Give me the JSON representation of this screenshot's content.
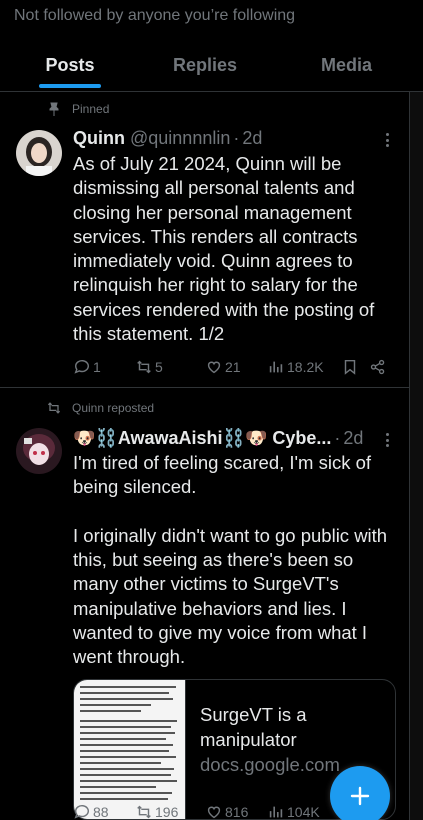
{
  "top_note": "Not followed by anyone you’re following",
  "tabs": [
    {
      "label": "Posts",
      "active": true
    },
    {
      "label": "Replies",
      "active": false
    },
    {
      "label": "Media",
      "active": false
    }
  ],
  "colors": {
    "accent": "#1d9bf0",
    "background": "#000000",
    "muted": "#71767b",
    "text": "#e7e9ea"
  },
  "posts": [
    {
      "context": "Pinned",
      "context_icon": "pin-icon",
      "name": "Quinn",
      "handle": "@quinnnnlin",
      "time": "2d",
      "text": "As of July 21 2024, Quinn will be dismissing all personal talents and closing her personal management services. This renders all contracts immediately void. Quinn agrees to relinquish her right to salary for the services rendered with the posting of this statement. 1/2",
      "replies": "1",
      "reposts": "5",
      "likes": "21",
      "views": "18.2K"
    },
    {
      "context": "Quinn reposted",
      "context_icon": "repost-icon",
      "name": "🐶⛓️AwawaAishi⛓️🐶 Cybe...",
      "time": "2d",
      "text": "I'm tired of feeling scared, I'm sick of being silenced.\n\nI originally didn't want to go public with this, but seeing as there's been so many other victims to SurgeVT's manipulative behaviors and lies. I wanted to give my voice from what I went through.",
      "card_title": "SurgeVT is a manipulator",
      "card_domain": "docs.google.com",
      "replies": "88",
      "reposts": "196",
      "likes": "816",
      "views": "104K"
    }
  ]
}
